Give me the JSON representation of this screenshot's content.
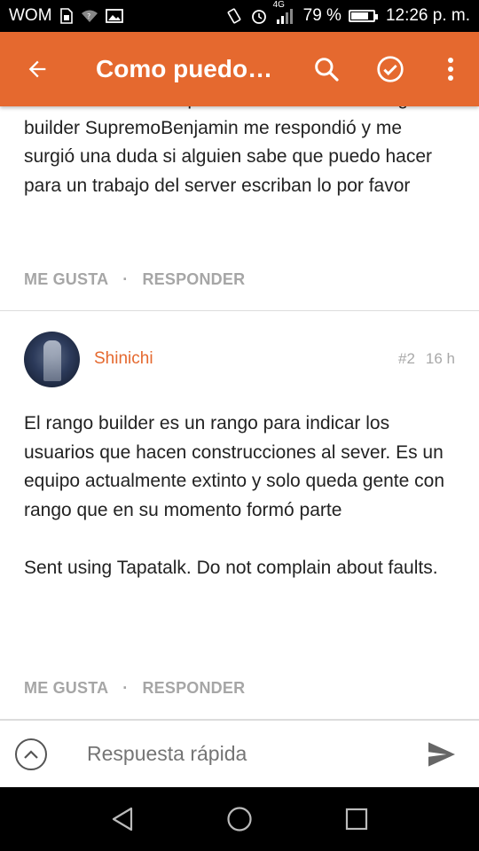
{
  "status_bar": {
    "carrier": "WOM",
    "network": "4G",
    "battery_percent": "79 %",
    "battery_level": 0.79,
    "time": "12:26 p. m."
  },
  "toolbar": {
    "title": "Como puedo…",
    "icons": [
      "back-arrow-icon",
      "search-icon",
      "check-circle-icon",
      "more-vert-icon"
    ]
  },
  "posts": [
    {
      "text": "Hola en mi Anterior post hablaba sobre el rango builder SupremoBenjamin me respondió y me surgió una duda si alguien sabe que puedo hacer para un trabajo del server escriban lo por favor",
      "like_label": "ME GUSTA",
      "separator": "·",
      "reply_label": "RESPONDER"
    },
    {
      "author": "Shinichi",
      "number": "#2",
      "time": "16 h",
      "text": "El rango builder es un rango para indicar los usuarios que hacen construcciones al sever. Es un equipo actualmente extinto y solo queda gente con rango que en su momento formó parte",
      "signature": "Sent using Tapatalk. Do not complain about faults.",
      "like_label": "ME GUSTA",
      "separator": "·",
      "reply_label": "RESPONDER"
    }
  ],
  "reply_bar": {
    "placeholder": "Respuesta rápida"
  },
  "colors": {
    "accent": "#e5692f",
    "muted": "#a6a6a6"
  }
}
